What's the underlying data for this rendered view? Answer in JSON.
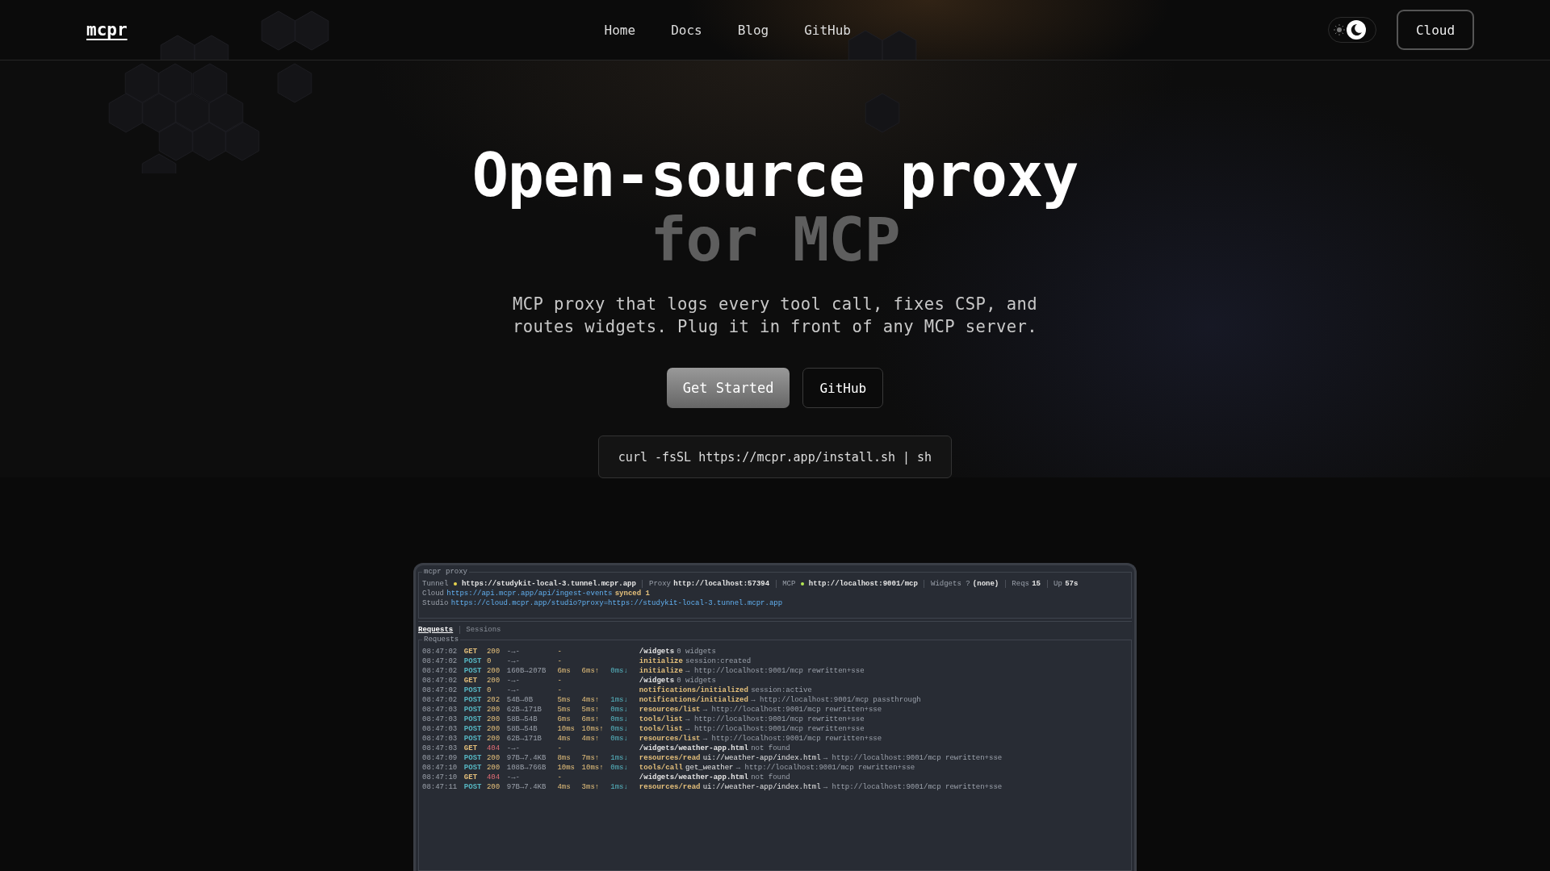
{
  "nav": {
    "logo": "mcpr",
    "links": [
      "Home",
      "Docs",
      "Blog",
      "GitHub"
    ],
    "dark_mode": true,
    "cloud_button": "Cloud"
  },
  "hero": {
    "title": "Open-source proxy",
    "title_muted": "for MCP",
    "subtitle": "MCP proxy that logs every tool call, fixes CSP, and routes widgets. Plug it in front of any MCP server.",
    "buttons": [
      {
        "label": "Get Started",
        "kind": "primary"
      },
      {
        "label": "GitHub",
        "kind": "outline"
      }
    ],
    "install_command": "curl -fsSL https://mcpr.app/install.sh | sh"
  },
  "terminal": {
    "title": "mcpr proxy",
    "status_items": [
      {
        "label": "Tunnel",
        "value": "https://studykit-local-3.tunnel.mcpr.app",
        "color": "#e8d44d"
      },
      {
        "label": "Proxy",
        "value": "http://localhost:57394"
      },
      {
        "label": "MCP",
        "value": "http://localhost:9001/mcp",
        "color": "#b5e853"
      },
      {
        "label": "Widgets ?",
        "value": "(none)"
      },
      {
        "label": "Reqs",
        "value": "15"
      },
      {
        "label": "Up",
        "value": "57s"
      }
    ],
    "cloud": {
      "label": "Cloud",
      "value": "https://api.mcpr.app/api/ingest-events",
      "status": "synced 1"
    },
    "studio": {
      "label": "Studio",
      "value": "https://cloud.mcpr.app/studio?proxy=https://studykit-local-3.tunnel.mcpr.app"
    },
    "tabs": [
      {
        "label": "Requests",
        "selected": true
      },
      {
        "label": "Sessions",
        "selected": false
      }
    ],
    "panel_title": "Requests",
    "rows": [
      {
        "time": "08:47:02",
        "method": "GET",
        "status": "200",
        "failed": false,
        "size": "-→-",
        "latency": "-",
        "up": "",
        "down": "",
        "kind": "route",
        "path": "/widgets",
        "detail": "0 widgets"
      },
      {
        "time": "08:47:02",
        "method": "POST",
        "status": "0",
        "failed": false,
        "size": "-→-",
        "latency": "-",
        "up": "",
        "down": "",
        "kind": "rpc",
        "path": "initialize",
        "detail": "session:created"
      },
      {
        "time": "08:47:02",
        "method": "POST",
        "status": "200",
        "failed": false,
        "size": "160B→207B",
        "latency": "6ms",
        "up": "6ms↑",
        "down": "0ms↓",
        "kind": "rpc",
        "path": "initialize",
        "detail": "→ http://localhost:9001/mcp rewritten+sse"
      },
      {
        "time": "08:47:02",
        "method": "GET",
        "status": "200",
        "failed": false,
        "size": "-→-",
        "latency": "-",
        "up": "",
        "down": "",
        "kind": "route",
        "path": "/widgets",
        "detail": "0 widgets"
      },
      {
        "time": "08:47:02",
        "method": "POST",
        "status": "0",
        "failed": false,
        "size": "-→-",
        "latency": "-",
        "up": "",
        "down": "",
        "kind": "rpc",
        "path": "notifications/initialized",
        "detail": "session:active"
      },
      {
        "time": "08:47:02",
        "method": "POST",
        "status": "202",
        "failed": false,
        "size": "54B→0B",
        "latency": "5ms",
        "up": "4ms↑",
        "down": "1ms↓",
        "kind": "rpc",
        "path": "notifications/initialized",
        "detail": "→ http://localhost:9001/mcp passthrough"
      },
      {
        "time": "08:47:03",
        "method": "POST",
        "status": "200",
        "failed": false,
        "size": "62B→171B",
        "latency": "5ms",
        "up": "5ms↑",
        "down": "0ms↓",
        "kind": "rpc",
        "path": "resources/list",
        "detail": "→ http://localhost:9001/mcp rewritten+sse"
      },
      {
        "time": "08:47:03",
        "method": "POST",
        "status": "200",
        "failed": false,
        "size": "58B→54B",
        "latency": "6ms",
        "up": "6ms↑",
        "down": "0ms↓",
        "kind": "rpc",
        "path": "tools/list",
        "detail": "→ http://localhost:9001/mcp rewritten+sse"
      },
      {
        "time": "08:47:03",
        "method": "POST",
        "status": "200",
        "failed": false,
        "size": "58B→54B",
        "latency": "10ms",
        "up": "10ms↑",
        "down": "0ms↓",
        "kind": "rpc",
        "path": "tools/list",
        "detail": "→ http://localhost:9001/mcp rewritten+sse"
      },
      {
        "time": "08:47:03",
        "method": "POST",
        "status": "200",
        "failed": false,
        "size": "62B→171B",
        "latency": "4ms",
        "up": "4ms↑",
        "down": "0ms↓",
        "kind": "rpc",
        "path": "resources/list",
        "detail": "→ http://localhost:9001/mcp rewritten+sse"
      },
      {
        "time": "08:47:03",
        "method": "GET",
        "status": "404",
        "failed": true,
        "size": "-→-",
        "latency": "-",
        "up": "",
        "down": "",
        "kind": "route",
        "path": "/widgets/weather-app.html",
        "detail": "not found"
      },
      {
        "time": "08:47:09",
        "method": "POST",
        "status": "200",
        "failed": false,
        "size": "97B→7.4KB",
        "latency": "8ms",
        "up": "7ms↑",
        "down": "1ms↓",
        "kind": "rpc",
        "path": "resources/read",
        "arg": "ui://weather-app/index.html",
        "detail": "→ http://localhost:9001/mcp rewritten+sse"
      },
      {
        "time": "08:47:10",
        "method": "POST",
        "status": "200",
        "failed": false,
        "size": "108B→766B",
        "latency": "10ms",
        "up": "10ms↑",
        "down": "0ms↓",
        "kind": "rpc",
        "path": "tools/call",
        "arg": "get_weather",
        "detail": "→ http://localhost:9001/mcp rewritten+sse"
      },
      {
        "time": "08:47:10",
        "method": "GET",
        "status": "404",
        "failed": true,
        "size": "-→-",
        "latency": "-",
        "up": "",
        "down": "",
        "kind": "route",
        "path": "/widgets/weather-app.html",
        "detail": "not found"
      },
      {
        "time": "08:47:11",
        "method": "POST",
        "status": "200",
        "failed": false,
        "size": "97B→7.4KB",
        "latency": "4ms",
        "up": "3ms↑",
        "down": "1ms↓",
        "kind": "rpc",
        "path": "resources/read",
        "arg": "ui://weather-app/index.html",
        "detail": "→ http://localhost:9001/mcp rewritten+sse"
      }
    ]
  }
}
